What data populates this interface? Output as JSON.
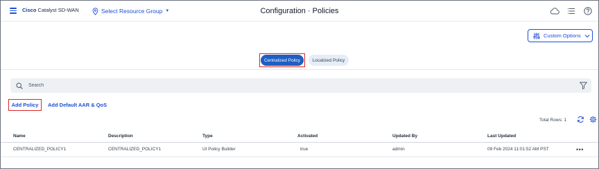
{
  "header": {
    "brand_bold": "Cisco",
    "brand_rest": " Catalyst SD-WAN",
    "resource_group": "Select Resource Group",
    "title": "Configuration · Policies"
  },
  "toolbar": {
    "custom_options": "Custom Options"
  },
  "tabs": [
    {
      "label": "Centralized Policy",
      "active": true
    },
    {
      "label": "Localized Policy",
      "active": false
    }
  ],
  "search": {
    "placeholder": "Search",
    "value": ""
  },
  "actions": {
    "add_policy": "Add Policy",
    "add_default": "Add Default AAR & QoS"
  },
  "table": {
    "total_rows": "Total Rows: 1",
    "columns": [
      "Name",
      "Description",
      "Type",
      "Activated",
      "Updated By",
      "Last Updated"
    ],
    "rows": [
      [
        "CENTRALIZED_POLICY1",
        "CENTRALIZED_POLICY1",
        "UI Policy Builder",
        "true",
        "admin",
        "09 Feb 2024 11:01:52 AM PST"
      ]
    ],
    "row_menu": "•••"
  },
  "colors": {
    "accent": "#1d4ed8",
    "active_tab": "#1d5fc4",
    "highlight_box": "#dc2626"
  },
  "icons": [
    "hamburger-icon",
    "location-pin-icon",
    "chevron-down-icon",
    "cloud-icon",
    "list-icon",
    "help-icon",
    "sliders-icon",
    "search-icon",
    "filter-icon",
    "refresh-icon",
    "settings-icon",
    "more-icon"
  ]
}
